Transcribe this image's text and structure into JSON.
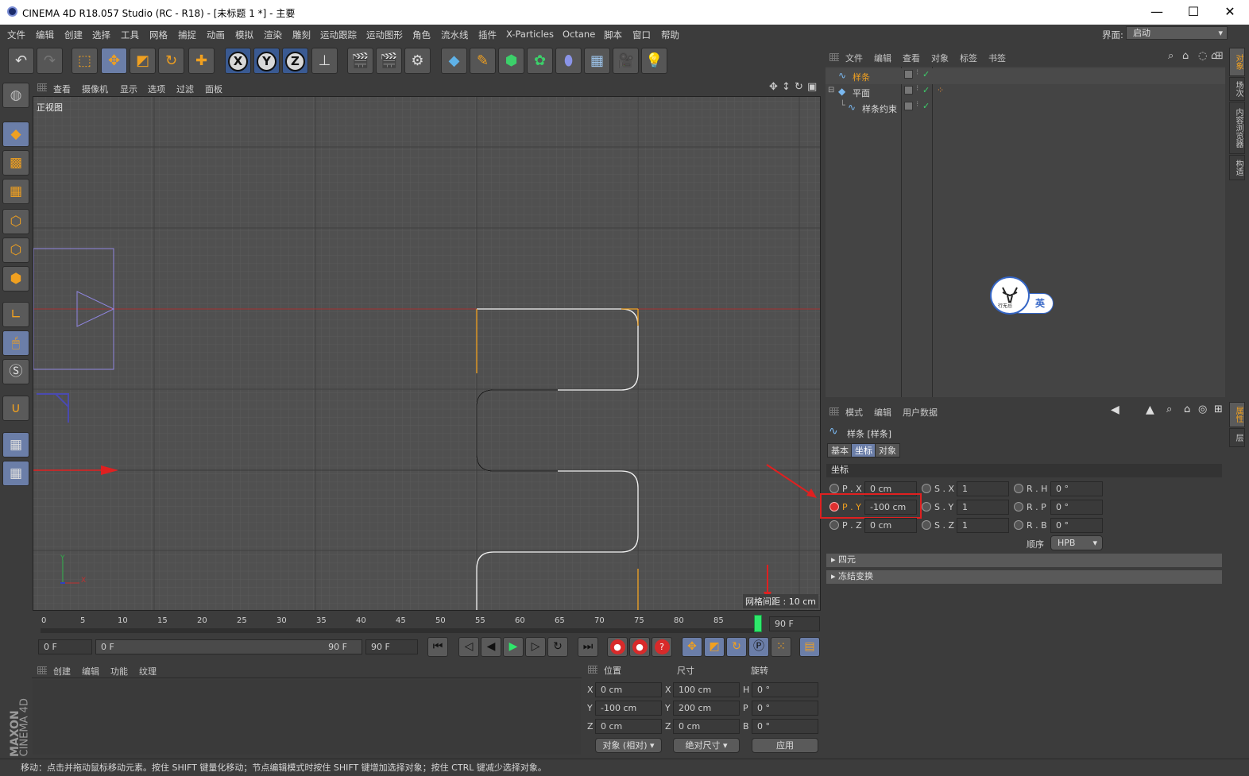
{
  "window": {
    "title": "CINEMA 4D R18.057 Studio (RC - R18) - [未标题 1 *] - 主要",
    "controls": [
      "—",
      "☐",
      "✕"
    ]
  },
  "menu": [
    "文件",
    "编辑",
    "创建",
    "选择",
    "工具",
    "网格",
    "捕捉",
    "动画",
    "模拟",
    "渲染",
    "雕刻",
    "运动跟踪",
    "运动图形",
    "角色",
    "流水线",
    "插件",
    "X-Particles",
    "Octane",
    "脚本",
    "窗口",
    "帮助"
  ],
  "layout": {
    "label": "界面:",
    "value": "启动"
  },
  "viewport": {
    "menu": [
      "查看",
      "摄像机",
      "显示",
      "选项",
      "过滤",
      "面板"
    ],
    "name": "正视图",
    "grid_spacing": "网格间距 : 10 cm",
    "axis_y": "Y",
    "axis_x": "X"
  },
  "timeline": {
    "ticks": [
      "0",
      "5",
      "10",
      "15",
      "20",
      "25",
      "30",
      "35",
      "40",
      "45",
      "50",
      "55",
      "60",
      "65",
      "70",
      "75",
      "80",
      "85"
    ],
    "current_frame": "90 F",
    "start_field": "0 F",
    "slider_start": "0 F",
    "slider_end": "90 F",
    "end_field": "90 F"
  },
  "material_manager": {
    "menu": [
      "创建",
      "编辑",
      "功能",
      "纹理"
    ]
  },
  "coordinates": {
    "headers": [
      "位置",
      "尺寸",
      "旋转"
    ],
    "rows": [
      {
        "axis": "X",
        "pos": "0 cm",
        "size_axis": "X",
        "size": "100 cm",
        "rot_axis": "H",
        "rot": "0 °"
      },
      {
        "axis": "Y",
        "pos": "-100 cm",
        "size_axis": "Y",
        "size": "200 cm",
        "rot_axis": "P",
        "rot": "0 °"
      },
      {
        "axis": "Z",
        "pos": "0 cm",
        "size_axis": "Z",
        "size": "0 cm",
        "rot_axis": "B",
        "rot": "0 °"
      }
    ],
    "mode": "对象 (相对)",
    "size_mode": "绝对尺寸",
    "apply": "应用"
  },
  "object_manager": {
    "menu": [
      "文件",
      "编辑",
      "查看",
      "对象",
      "标签",
      "书签"
    ],
    "objects": [
      {
        "name": "样条",
        "selected": true
      },
      {
        "name": "平面",
        "selected": false
      },
      {
        "name": "样条约束",
        "selected": false
      }
    ]
  },
  "attribute_manager": {
    "menu": [
      "模式",
      "编辑",
      "用户数据"
    ],
    "object_title": "样条 [样条]",
    "tabs": [
      "基本",
      "坐标",
      "对象"
    ],
    "active_tab": "坐标",
    "section": "坐标",
    "fields": {
      "px": {
        "label": "P . X",
        "value": "0 cm"
      },
      "py": {
        "label": "P . Y",
        "value": "-100 cm"
      },
      "pz": {
        "label": "P . Z",
        "value": "0 cm"
      },
      "sx": {
        "label": "S . X",
        "value": "1"
      },
      "sy": {
        "label": "S . Y",
        "value": "1"
      },
      "sz": {
        "label": "S . Z",
        "value": "1"
      },
      "rh": {
        "label": "R . H",
        "value": "0 °"
      },
      "rp": {
        "label": "R . P",
        "value": "0 °"
      },
      "rb": {
        "label": "R . B",
        "value": "0 °"
      }
    },
    "order_label": "顺序",
    "order_value": "HPB",
    "collapsed_sections": [
      "四元",
      "冻结变换"
    ]
  },
  "side_tabs": [
    "对象",
    "场次",
    "内容浏览器",
    "构造"
  ],
  "side_tabs_lower": [
    "属性",
    "层"
  ],
  "ime": {
    "label": "英",
    "logo_text": "行无忌"
  },
  "brand": {
    "line1": "MAXON",
    "line2": "CINEMA 4D"
  },
  "status": "移动：点击并拖动鼠标移动元素。按住 SHIFT 键量化移动；节点编辑模式时按住 SHIFT 键增加选择对象；按住 CTRL 键减少选择对象。",
  "colors": {
    "accent_orange": "#f0a020",
    "selection_blue": "#6b7ea8",
    "annotation_red": "#e02020",
    "viewport_bg": "#505050",
    "panel_bg": "#3c3c3c"
  }
}
